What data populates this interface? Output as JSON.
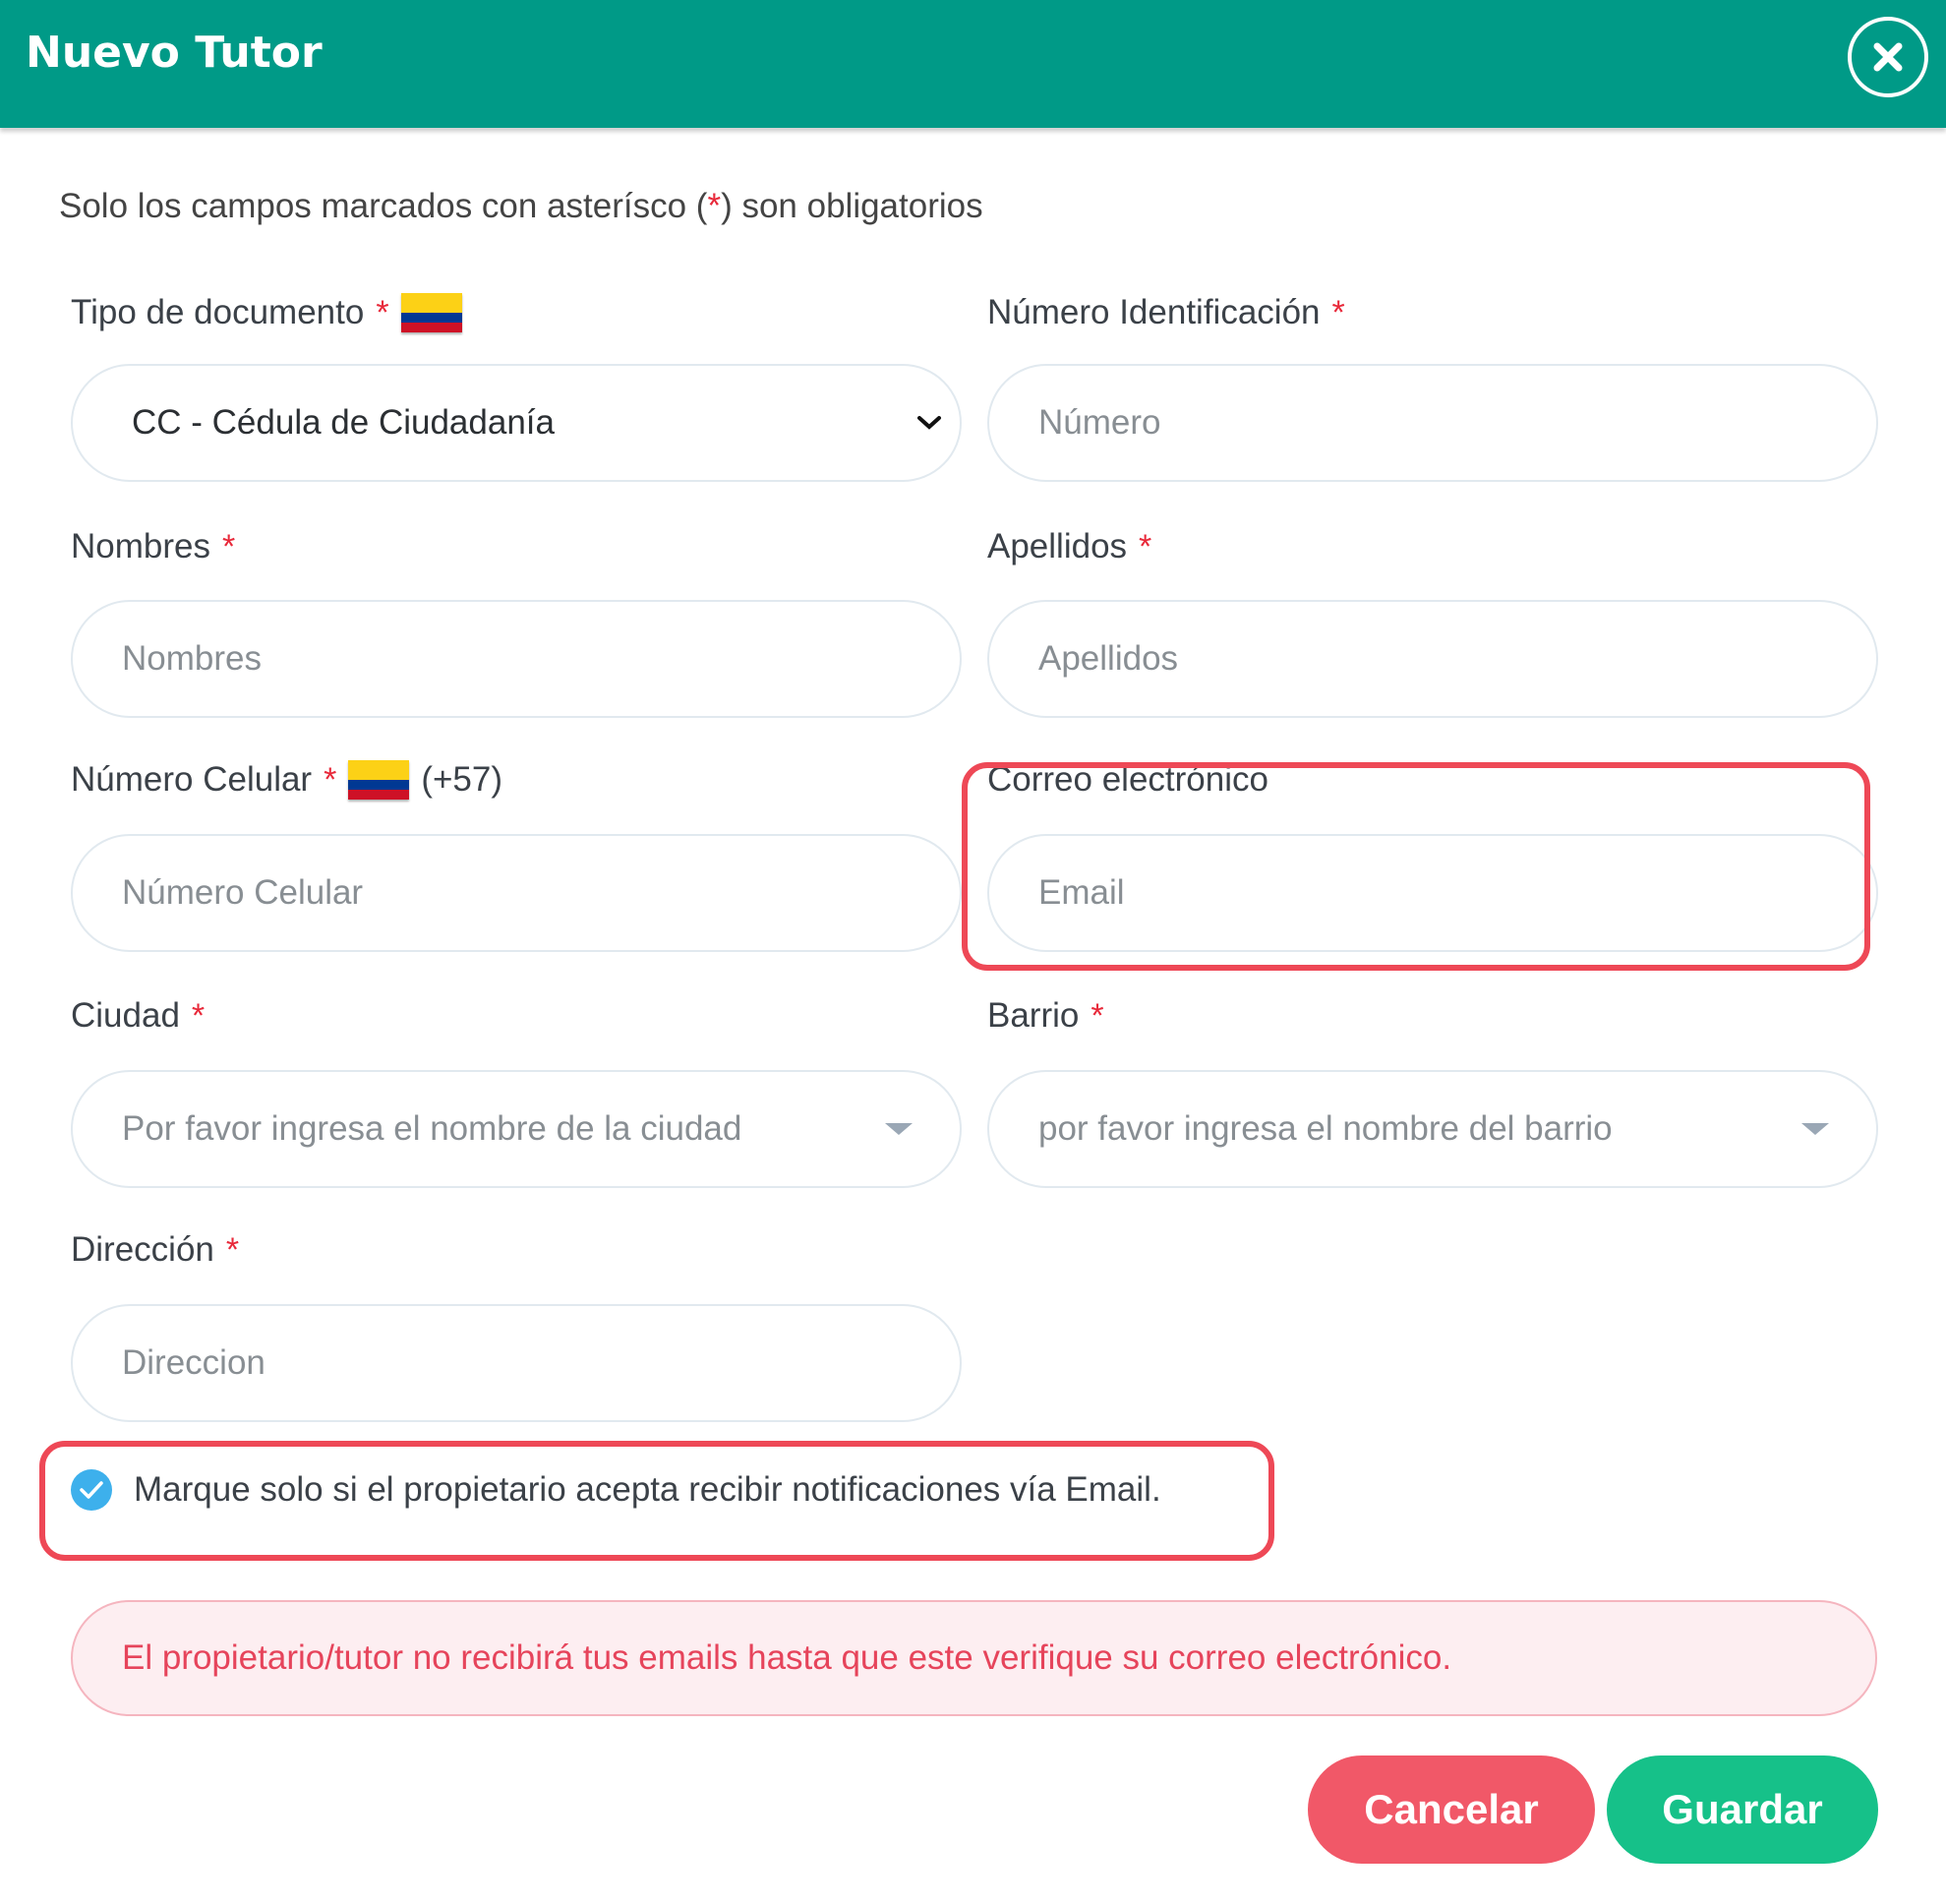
{
  "dialog": {
    "title": "Nuevo Tutor"
  },
  "note": {
    "prefix": "Solo los campos marcados con asterísco (",
    "star": "*",
    "suffix": ") son obligatorios"
  },
  "required_marker": "*",
  "fields": {
    "doc_type": {
      "label": "Tipo de documento",
      "value": "CC - Cédula de Ciudadanía"
    },
    "id_number": {
      "label": "Número Identificación",
      "placeholder": "Número"
    },
    "first_names": {
      "label": "Nombres",
      "placeholder": "Nombres"
    },
    "last_names": {
      "label": "Apellidos",
      "placeholder": "Apellidos"
    },
    "mobile": {
      "label": "Número Celular",
      "country_code": "(+57)",
      "placeholder": "Número Celular"
    },
    "email": {
      "label": "Correo electrónico",
      "placeholder": "Email"
    },
    "city": {
      "label": "Ciudad",
      "placeholder": "Por favor ingresa el nombre de la ciudad"
    },
    "neighborhood": {
      "label": "Barrio",
      "placeholder": "por favor ingresa el nombre del barrio"
    },
    "address": {
      "label": "Dirección",
      "placeholder": "Direccion"
    }
  },
  "email_consent": {
    "label": "Marque solo si el propietario acepta recibir notificaciones vía Email.",
    "checked": true
  },
  "alert": {
    "text": "El propietario/tutor no recibirá tus emails hasta que este verifique su correo electrónico."
  },
  "buttons": {
    "cancel": "Cancelar",
    "save": "Guardar"
  },
  "colors": {
    "header": "#009a87",
    "required": "#e8293a",
    "highlight": "#ee4856",
    "cancel": "#f15868",
    "save": "#16c189",
    "check": "#3db0ec",
    "alert_text": "#e6445b"
  }
}
